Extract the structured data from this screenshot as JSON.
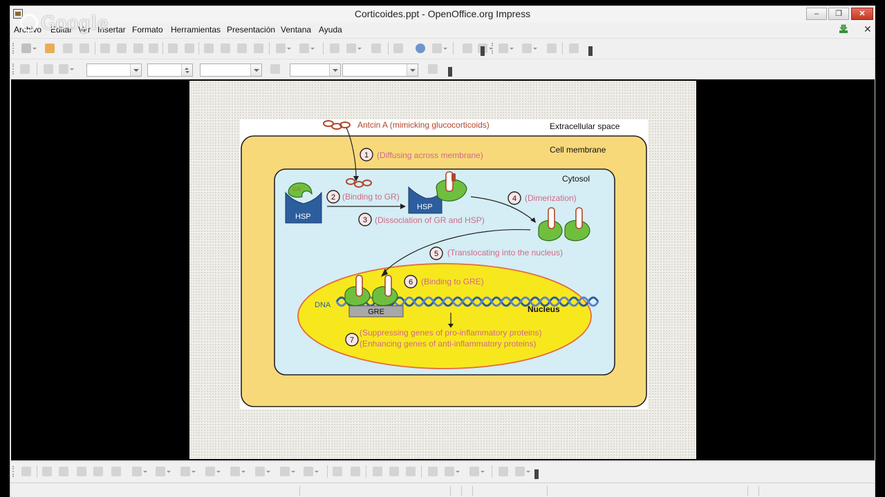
{
  "window": {
    "title": "Corticoides.ppt - OpenOffice.org Impress",
    "minimize_symbol": "–",
    "maximize_symbol": "❐",
    "close_symbol": "✕"
  },
  "watermark": {
    "text": "Google"
  },
  "menu": {
    "items": [
      "Archivo",
      "Editar",
      "Ver",
      "Insertar",
      "Formato",
      "Herramientas",
      "Presentación",
      "Ventana",
      "Ayuda"
    ],
    "close_doc_symbol": "✕"
  },
  "slide": {
    "ligand_label": "Antcin A (mimicking glucocorticoids)",
    "extracellular_label": "Extracellular space",
    "membrane_label": "Cell membrane",
    "cytosol_label": "Cytosol",
    "nucleus_label": "Nucleus",
    "dna_label": "DNA",
    "gre_label": "GRE",
    "hsp_label": "HSP",
    "gr_label": "GR",
    "steps": [
      {
        "num": "1",
        "text": "(Diffusing across membrane)"
      },
      {
        "num": "2",
        "text": "(Binding to GR)"
      },
      {
        "num": "3",
        "text": "(Dissociation of GR and HSP)"
      },
      {
        "num": "4",
        "text": "(Dimerization)"
      },
      {
        "num": "5",
        "text": "(Translocating into the nucleus)"
      },
      {
        "num": "6",
        "text": "(Binding to GRE)"
      },
      {
        "num": "7",
        "text": "(Suppressing genes of pro-inflammatory proteins)"
      }
    ],
    "step7_line2": "(Enhancing genes of anti-inflammatory proteins)"
  },
  "colors": {
    "membrane_fill": "#f8d97a",
    "cytosol_fill": "#d5edf4",
    "nucleus_fill": "#f7e81e",
    "gr_green": "#6fbf3f",
    "hsp_blue": "#2c5e9e",
    "step_text": "#d06a86",
    "ligand_text": "#b2452a"
  }
}
